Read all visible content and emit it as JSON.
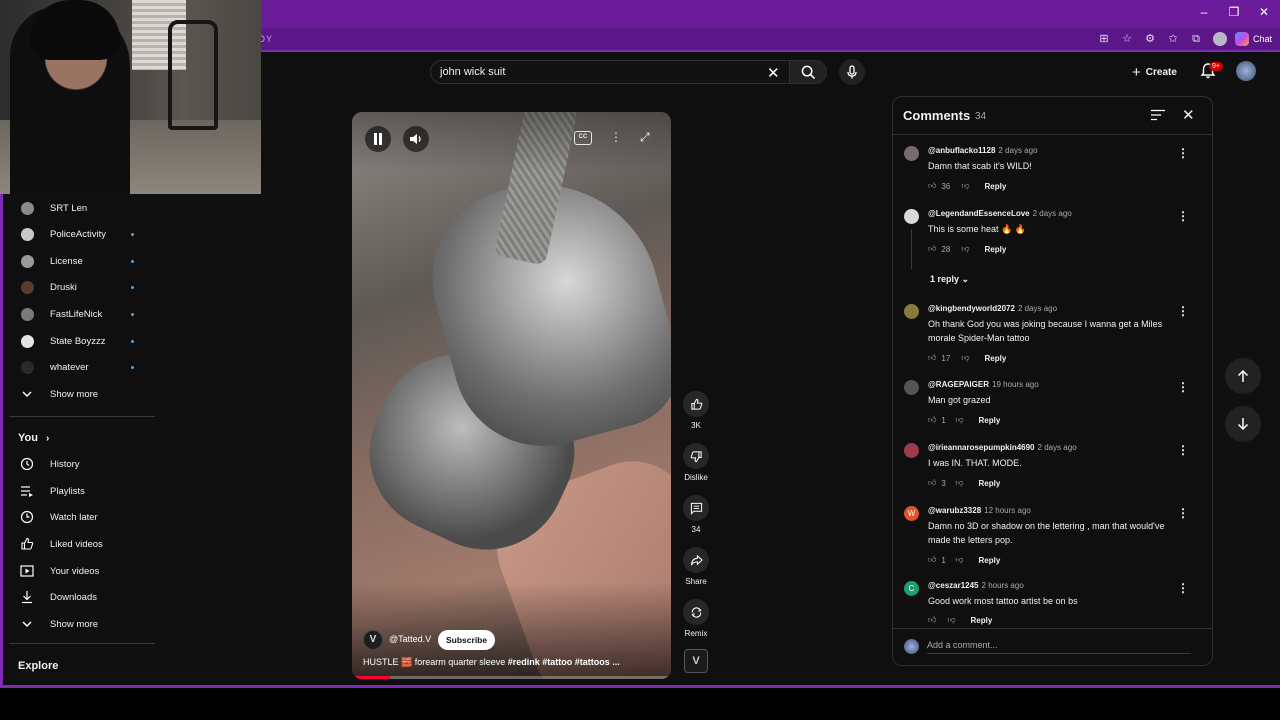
{
  "browser": {
    "address_fragment": "OY",
    "chat_label": "Chat"
  },
  "search": {
    "query": "john wick suit"
  },
  "header": {
    "create_label": "Create",
    "notification_badge": "9+"
  },
  "sidebar": {
    "subscriptions": [
      {
        "label": "SRT Len",
        "new": false
      },
      {
        "label": "PoliceActivity",
        "new": true
      },
      {
        "label": "License",
        "new": true
      },
      {
        "label": "Druski",
        "new": true
      },
      {
        "label": "FastLifeNick",
        "new": true
      },
      {
        "label": "State Boyzzz",
        "new": true
      },
      {
        "label": "whatever",
        "new": true
      }
    ],
    "show_more_1": "Show more",
    "you_heading": "You",
    "you_items": [
      {
        "label": "History",
        "icon": "history-icon"
      },
      {
        "label": "Playlists",
        "icon": "playlists-icon"
      },
      {
        "label": "Watch later",
        "icon": "watch-later-icon"
      },
      {
        "label": "Liked videos",
        "icon": "liked-icon"
      },
      {
        "label": "Your videos",
        "icon": "your-videos-icon"
      },
      {
        "label": "Downloads",
        "icon": "downloads-icon"
      }
    ],
    "show_more_2": "Show more",
    "explore_heading": "Explore"
  },
  "video": {
    "channel_handle": "@Tatted.V",
    "channel_initial": "V",
    "subscribe_label": "Subscribe",
    "title_plain": "HUSTLE 🧱 forearm quarter sleeve ",
    "title_tags": "#redink #tattoo #tattoos ...",
    "cc_label": "CC",
    "progress": 0.12
  },
  "actions": {
    "likes": "3K",
    "dislike": "Dislike",
    "comments": "34",
    "share": "Share",
    "remix": "Remix"
  },
  "comments": {
    "title": "Comments",
    "count": "34",
    "items": [
      {
        "author": "@anbuflacko1128",
        "time": "2 days ago",
        "text": "Damn that scab it's WILD!",
        "likes": "36",
        "avatar_color": "#7a6a6a",
        "avatar_letter": ""
      },
      {
        "author": "@LegendandEssenceLove",
        "time": "2 days ago",
        "text": "This is some heat 🔥 🔥",
        "likes": "28",
        "avatar_color": "#d9d9d9",
        "avatar_letter": ""
      },
      {
        "author": "@kingbendyworld2072",
        "time": "2 days ago",
        "text": "Oh thank God you was joking because I wanna get a  Miles morale Spider-Man tattoo",
        "likes": "17",
        "avatar_color": "#8a7a3a",
        "avatar_letter": ""
      },
      {
        "author": "@RAGEPAIGER",
        "time": "19 hours ago",
        "text": "Man got grazed",
        "likes": "1",
        "avatar_color": "#555555",
        "avatar_letter": ""
      },
      {
        "author": "@irieannarosepumpkin4690",
        "time": "2 days ago",
        "text": "I was IN. THAT. MODE.",
        "likes": "3",
        "avatar_color": "#a03a4a",
        "avatar_letter": ""
      },
      {
        "author": "@warubz3328",
        "time": "12 hours ago",
        "text": "Damn no 3D or shadow on the lettering , man that would've made the letters pop.",
        "likes": "1",
        "avatar_color": "#e0522a",
        "avatar_letter": "W"
      },
      {
        "author": "@ceszar1245",
        "time": "2 hours ago",
        "text": "Good work most tattoo artist be on bs",
        "likes": "",
        "avatar_color": "#1f9d6a",
        "avatar_letter": "C"
      }
    ],
    "reply_label": "Reply",
    "replies_toggle": "1 reply",
    "add_placeholder": "Add a comment..."
  }
}
